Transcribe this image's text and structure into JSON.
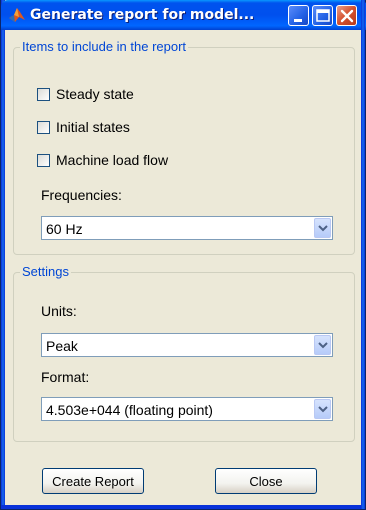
{
  "window": {
    "title": "Generate report for model...",
    "colors": {
      "titlebar": "#0053ee",
      "face": "#ece9d8",
      "legend_text": "#0046d5"
    },
    "controls": [
      "minimize-icon",
      "maximize-icon",
      "close-icon"
    ]
  },
  "items_group": {
    "legend": "Items to include in the report",
    "checkboxes": [
      {
        "label": "Steady state",
        "checked": false
      },
      {
        "label": "Initial states",
        "checked": false
      },
      {
        "label": "Machine load flow",
        "checked": false
      }
    ],
    "frequencies_label": "Frequencies:",
    "frequencies_value": "60 Hz"
  },
  "settings_group": {
    "legend": "Settings",
    "units_label": "Units:",
    "units_value": "Peak",
    "format_label": "Format:",
    "format_value": "4.503e+044 (floating point)"
  },
  "buttons": {
    "create": "Create Report",
    "close": "Close"
  }
}
